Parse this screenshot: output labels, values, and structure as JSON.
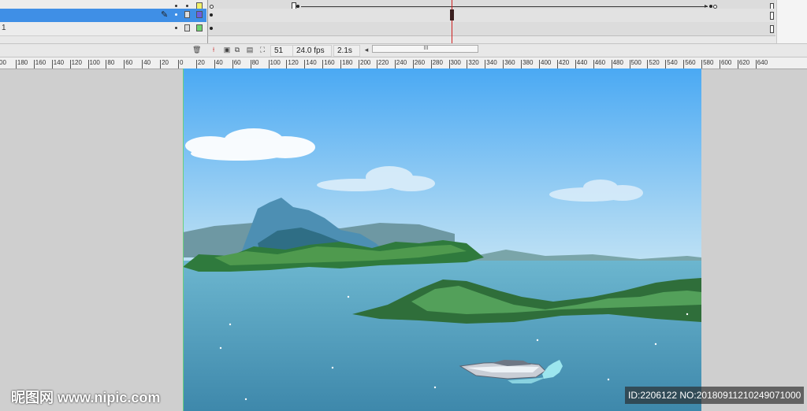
{
  "timeline": {
    "layers": [
      {
        "name": "",
        "selected": false,
        "color": "#f1f16a"
      },
      {
        "name": "",
        "selected": true,
        "color": "#6b5fe0"
      },
      {
        "name": "1",
        "selected": false,
        "color": "#6fd36f"
      }
    ]
  },
  "statusbar": {
    "current_frame": "51",
    "frame_rate": "24.0 fps",
    "elapsed_time": "2.1s",
    "scroll_thumb": "III",
    "scroll_left": "◂"
  },
  "ruler": {
    "labels": [
      "00",
      "180",
      "160",
      "140",
      "120",
      "100",
      "80",
      "60",
      "40",
      "20",
      "0",
      "20",
      "40",
      "60",
      "80",
      "100",
      "120",
      "140",
      "160",
      "180",
      "200",
      "220",
      "240",
      "260",
      "280",
      "300",
      "320",
      "340",
      "360",
      "380",
      "400",
      "420",
      "440",
      "460",
      "480",
      "500",
      "520",
      "540",
      "560",
      "580",
      "600",
      "620",
      "640"
    ]
  },
  "watermark": {
    "left_text": "昵图网 www.nipic.com",
    "right_text": "ID:2206122 NO:20180911210249071000"
  },
  "colors": {
    "sky_top": "#4aa9f3",
    "sky_bottom": "#b5dcf4",
    "water": "#4f9bbd",
    "selected_layer": "#3f8fe6"
  }
}
